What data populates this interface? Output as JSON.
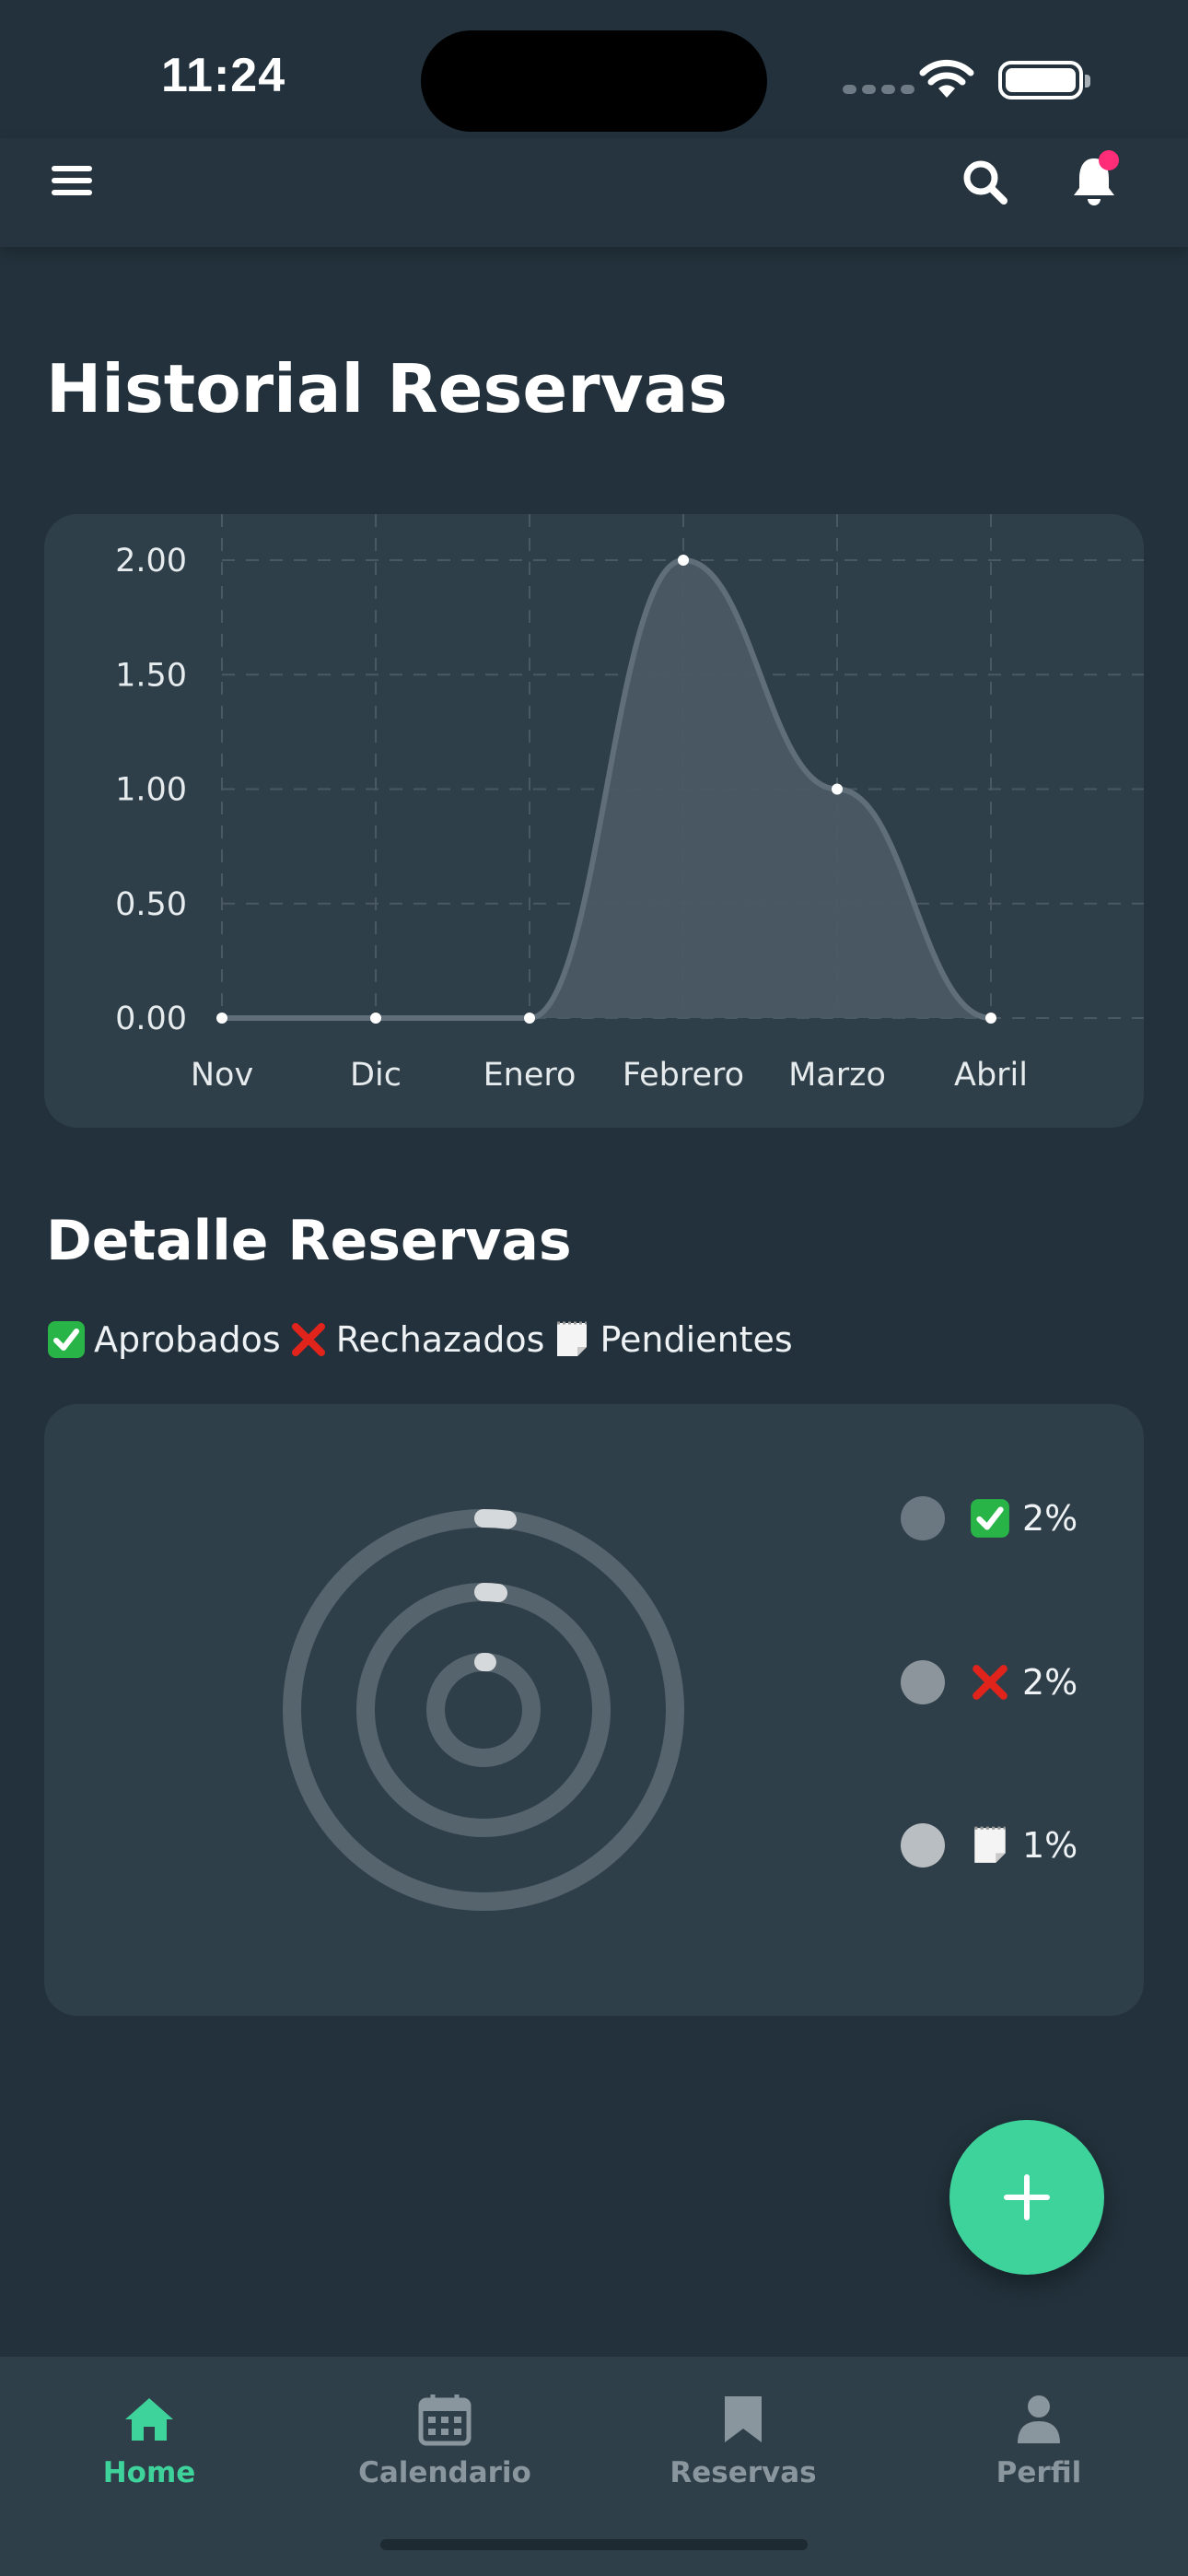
{
  "status_bar": {
    "time": "11:24"
  },
  "header": {
    "menu_icon": "menu-icon",
    "search_icon": "search-icon",
    "bell_icon": "bell-icon",
    "notification_dot_color": "#ff2d78"
  },
  "page": {
    "title": "Historial Reservas",
    "detail_title": "Detalle Reservas"
  },
  "status_legend": [
    {
      "icon": "check-mark-icon",
      "label": "Aprobados"
    },
    {
      "icon": "cross-mark-icon",
      "label": "Rechazados"
    },
    {
      "icon": "notepad-icon",
      "label": "Pendientes"
    }
  ],
  "chart_data": [
    {
      "type": "area",
      "categories": [
        "Nov",
        "Dic",
        "Enero",
        "Febrero",
        "Marzo",
        "Abril"
      ],
      "series": [
        {
          "values": [
            0,
            0,
            0,
            2,
            1,
            0
          ]
        }
      ],
      "y_ticks": [
        "0.00",
        "0.50",
        "1.00",
        "1.50",
        "2.00"
      ],
      "ylim": [
        0,
        2
      ],
      "grid": true,
      "title": "",
      "xlabel": "",
      "ylabel": "",
      "line_color": "#5f6e78",
      "fill_color": "#4b5a65"
    },
    {
      "type": "radial_bar",
      "series": [
        {
          "icon": "check-mark-icon",
          "value_label": "2%",
          "value": 2,
          "color": "#6b7781"
        },
        {
          "icon": "cross-mark-icon",
          "value_label": "2%",
          "value": 2,
          "color": "#8c959c"
        },
        {
          "icon": "notepad-icon",
          "value_label": "1%",
          "value": 1,
          "color": "#b9bec2"
        }
      ],
      "track_color": "#56646e"
    }
  ],
  "fab": {
    "label": "+",
    "color": "#3fd39c"
  },
  "bottom_nav": [
    {
      "label": "Home",
      "icon": "home-icon",
      "active": true
    },
    {
      "label": "Calendario",
      "icon": "calendar-icon",
      "active": false
    },
    {
      "label": "Reservas",
      "icon": "bookmark-icon",
      "active": false
    },
    {
      "label": "Perfil",
      "icon": "person-icon",
      "active": false
    }
  ],
  "colors": {
    "background": "#22313b",
    "card": "#2f3f49",
    "accent": "#3fd39c"
  }
}
